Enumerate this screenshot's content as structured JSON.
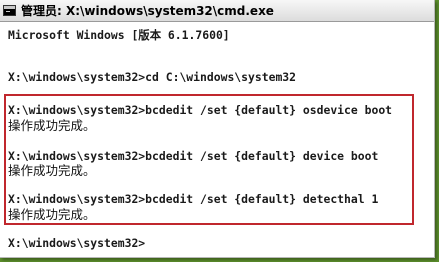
{
  "window": {
    "title": "管理员: X:\\windows\\system32\\cmd.exe",
    "icon": "cmd-icon"
  },
  "console": {
    "header_line": "Microsoft Windows [版本 6.1.7600]",
    "cd_command": "X:\\windows\\system32>cd C:\\windows\\system32",
    "cmd1": "X:\\windows\\system32>bcdedit /set {default} osdevice boot",
    "result1": "操作成功完成。",
    "cmd2": "X:\\windows\\system32>bcdedit /set {default} device boot",
    "result2": "操作成功完成。",
    "cmd3": "X:\\windows\\system32>bcdedit /set {default} detecthal 1",
    "result3": "操作成功完成。",
    "prompt": "X:\\windows\\system32>"
  },
  "colors": {
    "highlight_border": "#c0272d",
    "background_green": "#6fa33a"
  }
}
